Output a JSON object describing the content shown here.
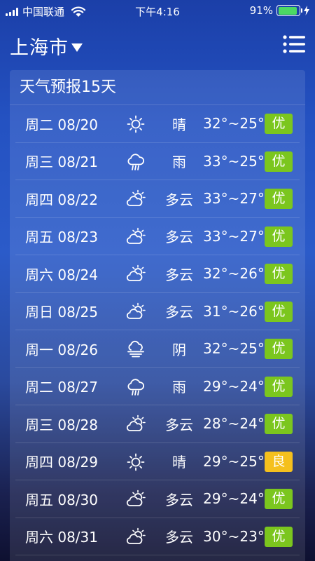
{
  "status": {
    "carrier": "中国联通",
    "time": "下午4:16",
    "battery": "91%",
    "battery_level": 0.91,
    "battery_color": "#4cd964"
  },
  "header": {
    "city": "上海市"
  },
  "card": {
    "title": "天气预报15天"
  },
  "colors": {
    "good": "#7bc61e",
    "moderate": "#f5c01d"
  },
  "forecast": [
    {
      "date": "周二 08/20",
      "icon": "sun-icon",
      "cond": "晴",
      "temp": "32°~25°",
      "aqi": "优",
      "level": "good"
    },
    {
      "date": "周三 08/21",
      "icon": "rain-icon",
      "cond": "雨",
      "temp": "33°~25°",
      "aqi": "优",
      "level": "good"
    },
    {
      "date": "周四 08/22",
      "icon": "partly-cloudy-icon",
      "cond": "多云",
      "temp": "33°~27°",
      "aqi": "优",
      "level": "good"
    },
    {
      "date": "周五 08/23",
      "icon": "partly-cloudy-icon",
      "cond": "多云",
      "temp": "33°~27°",
      "aqi": "优",
      "level": "good"
    },
    {
      "date": "周六 08/24",
      "icon": "partly-cloudy-icon",
      "cond": "多云",
      "temp": "32°~26°",
      "aqi": "优",
      "level": "good"
    },
    {
      "date": "周日 08/25",
      "icon": "partly-cloudy-icon",
      "cond": "多云",
      "temp": "31°~26°",
      "aqi": "优",
      "level": "good"
    },
    {
      "date": "周一 08/26",
      "icon": "overcast-icon",
      "cond": "阴",
      "temp": "32°~25°",
      "aqi": "优",
      "level": "good"
    },
    {
      "date": "周二 08/27",
      "icon": "rain-icon",
      "cond": "雨",
      "temp": "29°~24°",
      "aqi": "优",
      "level": "good"
    },
    {
      "date": "周三 08/28",
      "icon": "partly-cloudy-icon",
      "cond": "多云",
      "temp": "28°~24°",
      "aqi": "优",
      "level": "good"
    },
    {
      "date": "周四 08/29",
      "icon": "sun-icon",
      "cond": "晴",
      "temp": "29°~25°",
      "aqi": "良",
      "level": "moderate"
    },
    {
      "date": "周五 08/30",
      "icon": "partly-cloudy-icon",
      "cond": "多云",
      "temp": "29°~24°",
      "aqi": "优",
      "level": "good"
    },
    {
      "date": "周六 08/31",
      "icon": "partly-cloudy-icon",
      "cond": "多云",
      "temp": "30°~23°",
      "aqi": "优",
      "level": "good"
    }
  ]
}
